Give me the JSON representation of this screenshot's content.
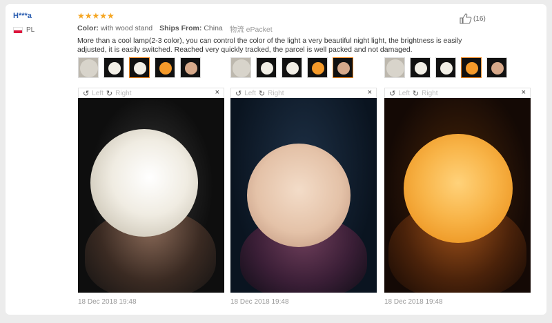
{
  "review": {
    "user": "H***a",
    "country": "PL",
    "stars": "★★★★★",
    "color_label": "Color:",
    "color_value": "with wood stand",
    "ships_label": "Ships From:",
    "ships_value": "China",
    "shipping": "物流 ePacket",
    "likes": "(16)",
    "text": "More than a cool lamp(2-3 color), you can control the color of the light a very beautiful night light, the brightness is easily adjusted, it is easily switched. Reached very quickly tracked, the parcel is well packed and not damaged."
  },
  "toolbar": {
    "left": "Left",
    "right": "Right",
    "close": "×"
  },
  "photos": [
    {
      "date": "18 Dec 2018 19:48",
      "active": 2,
      "moon_color": "#f2efe6",
      "bg": "#0d0d0d"
    },
    {
      "date": "18 Dec 2018 19:48",
      "active": 4,
      "moon_color": "#e8c9b0",
      "bg": "#0b1623"
    },
    {
      "date": "18 Dec 2018 19:48",
      "active": 3,
      "moon_color": "#f5a33a",
      "bg": "#140905"
    }
  ],
  "thumb_colors": [
    "#cfcac0",
    "#f2efe6",
    "#f2efe6",
    "#f59a2a",
    "#d7a98a"
  ]
}
